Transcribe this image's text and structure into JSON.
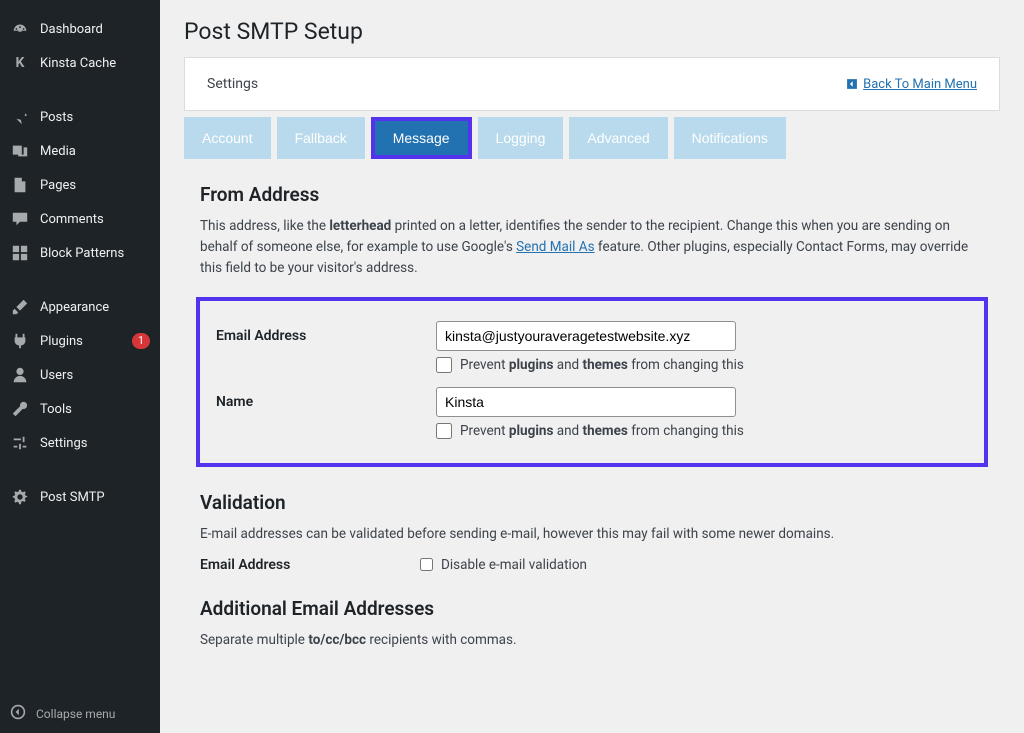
{
  "sidebar": {
    "items": [
      {
        "label": "Dashboard",
        "icon": "dashboard"
      },
      {
        "label": "Kinsta Cache",
        "icon": "kinsta"
      },
      {
        "label": "Posts",
        "icon": "pin"
      },
      {
        "label": "Media",
        "icon": "media"
      },
      {
        "label": "Pages",
        "icon": "pages"
      },
      {
        "label": "Comments",
        "icon": "comment"
      },
      {
        "label": "Block Patterns",
        "icon": "blocks"
      },
      {
        "label": "Appearance",
        "icon": "brush"
      },
      {
        "label": "Plugins",
        "icon": "plug",
        "badge": "1"
      },
      {
        "label": "Users",
        "icon": "user"
      },
      {
        "label": "Tools",
        "icon": "wrench"
      },
      {
        "label": "Settings",
        "icon": "sliders"
      },
      {
        "label": "Post SMTP",
        "icon": "gear"
      }
    ],
    "collapse": "Collapse menu"
  },
  "page": {
    "title": "Post SMTP Setup",
    "settings_label": "Settings",
    "back_link": "Back To Main Menu"
  },
  "tabs": [
    {
      "label": "Account",
      "active": false
    },
    {
      "label": "Fallback",
      "active": false
    },
    {
      "label": "Message",
      "active": true,
      "highlight": true
    },
    {
      "label": "Logging",
      "active": false
    },
    {
      "label": "Advanced",
      "active": false
    },
    {
      "label": "Notifications",
      "active": false
    }
  ],
  "from_section": {
    "title": "From Address",
    "desc_parts": {
      "p1": "This address, like the ",
      "b1": "letterhead",
      "p2": " printed on a letter, identifies the sender to the recipient. Change this when you are sending on behalf of someone else, for example to use Google's ",
      "link": "Send Mail As",
      "p3": " feature. Other plugins, especially Contact Forms, may override this field to be your visitor's address."
    },
    "email_label": "Email Address",
    "email_value": "kinsta@justyouraveragetestwebsite.xyz",
    "prevent_prefix": "Prevent ",
    "prevent_b1": "plugins",
    "prevent_mid": " and ",
    "prevent_b2": "themes",
    "prevent_suffix": " from changing this",
    "name_label": "Name",
    "name_value": "Kinsta"
  },
  "validation_section": {
    "title": "Validation",
    "desc": "E-mail addresses can be validated before sending e-mail, however this may fail with some newer domains.",
    "row_label": "Email Address",
    "checkbox_label": "Disable e-mail validation"
  },
  "additional_section": {
    "title": "Additional Email Addresses",
    "desc_prefix": "Separate multiple ",
    "desc_bold": "to/cc/bcc",
    "desc_suffix": " recipients with commas."
  }
}
